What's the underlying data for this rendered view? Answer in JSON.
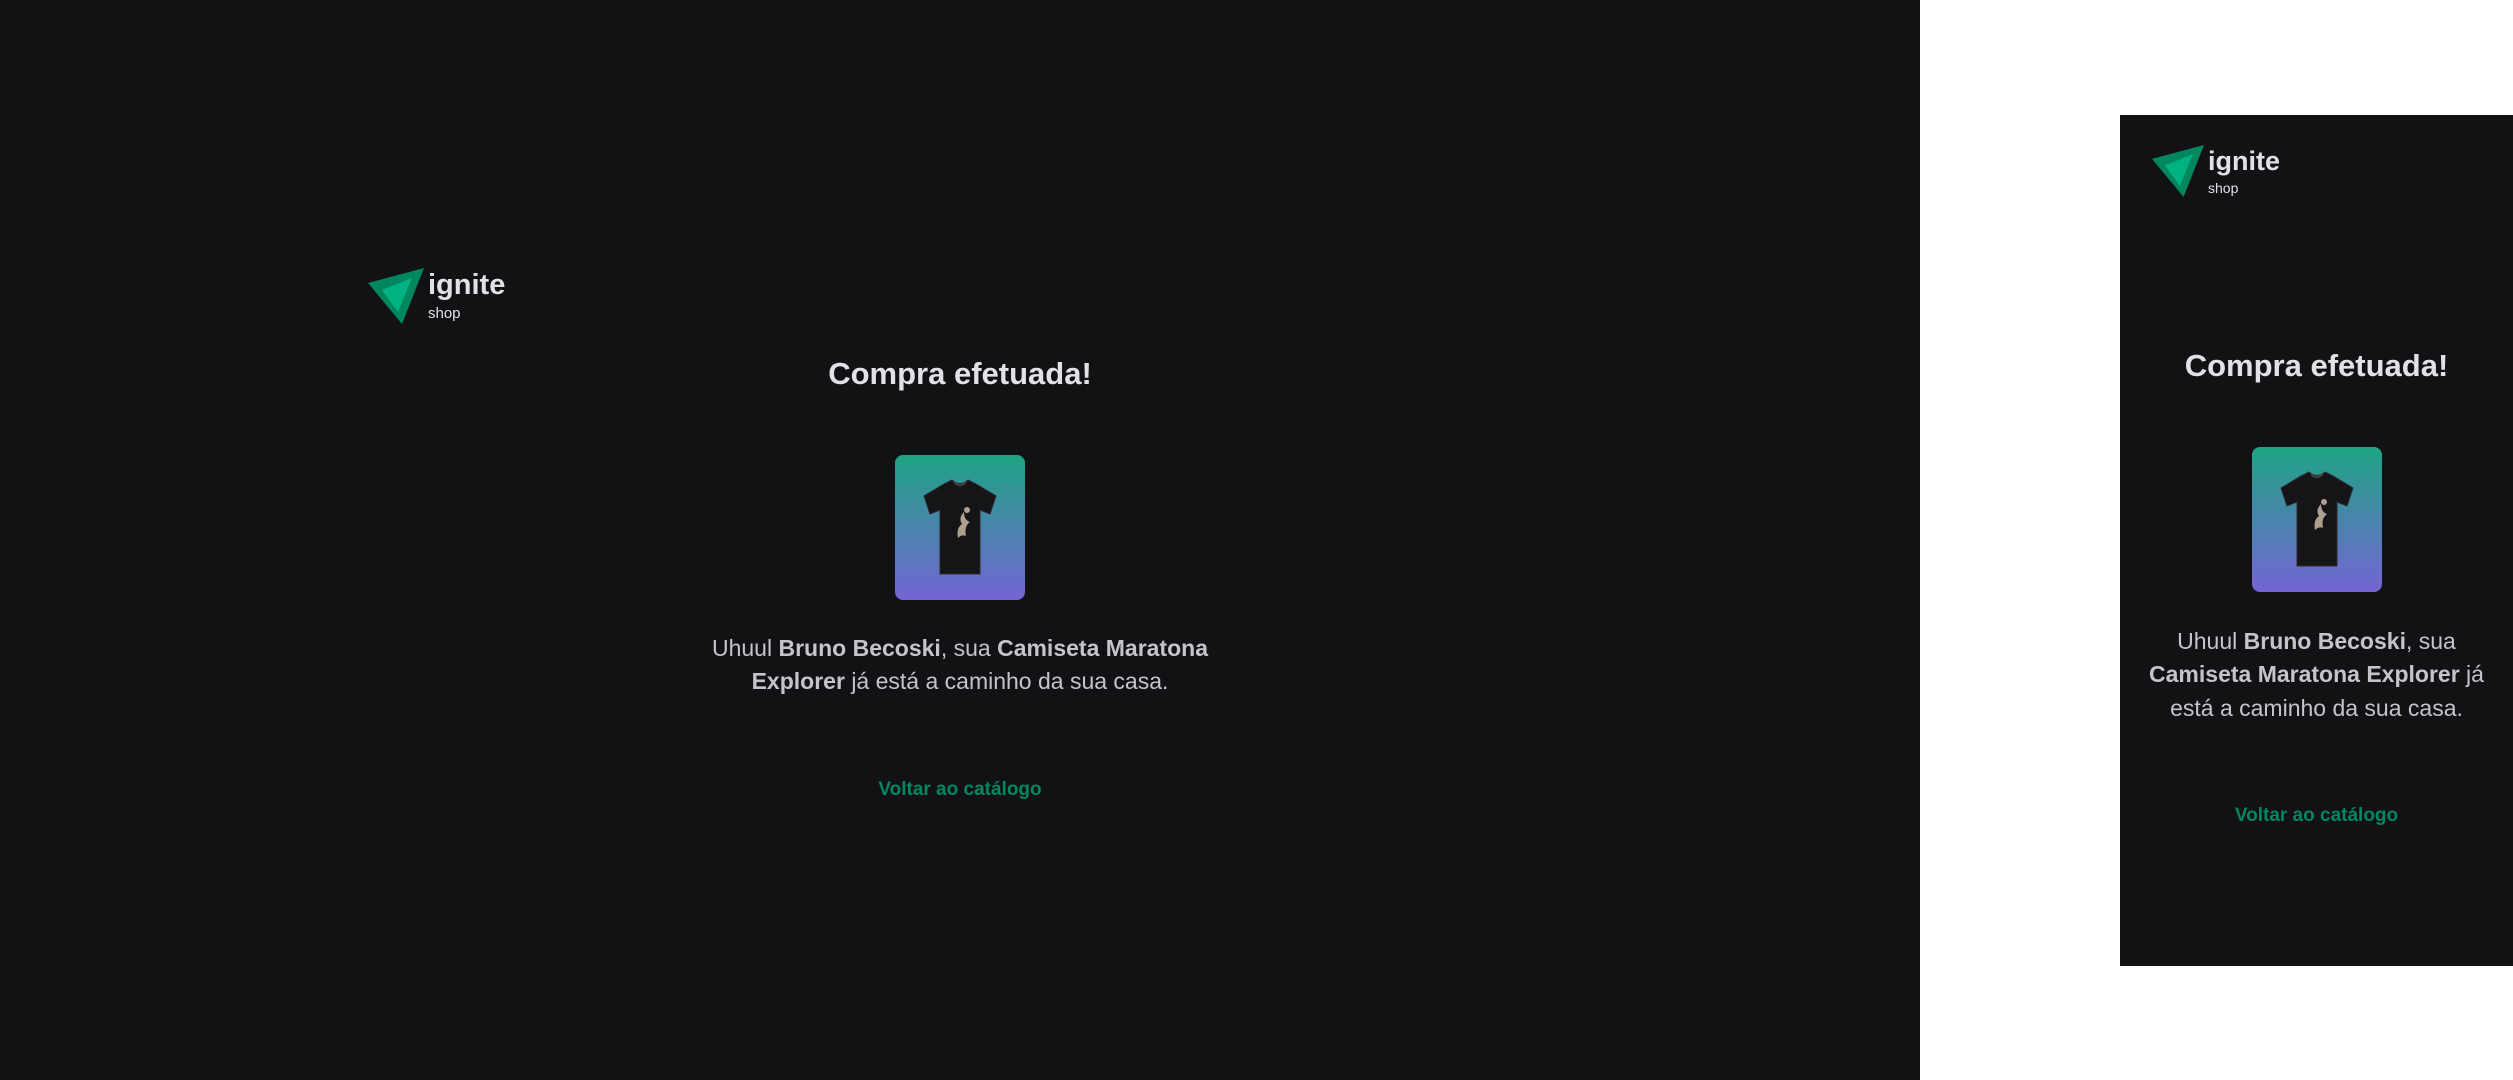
{
  "brand": {
    "title": "ignite",
    "subtitle": "shop"
  },
  "success": {
    "heading": "Compra efetuada!",
    "greeting": "Uhuul",
    "customer_name": "Bruno Becoski",
    "connector": ", sua",
    "product_name": "Camiseta Maratona Explorer",
    "ending": "já está a caminho da sua casa.",
    "back_link": "Voltar ao catálogo"
  },
  "colors": {
    "background": "#121214",
    "text": "#e1e1e6",
    "link": "#00875f",
    "image_gradient_start": "#1ea483",
    "image_gradient_end": "#7465d4"
  },
  "icons": {
    "logo": "ignite-logo-icon",
    "product": "tshirt-icon"
  }
}
